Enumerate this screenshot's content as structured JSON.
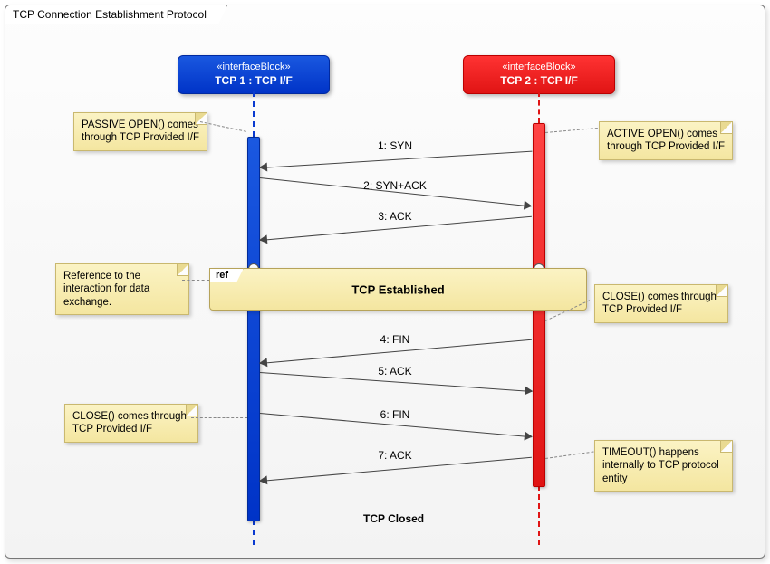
{
  "frame": {
    "title": "TCP Connection Establishment Protocol"
  },
  "lifelines": {
    "tcp1": {
      "stereotype": "«interfaceBlock»",
      "name": "TCP 1 : TCP I/F"
    },
    "tcp2": {
      "stereotype": "«interfaceBlock»",
      "name": "TCP 2 : TCP I/F"
    }
  },
  "messages": {
    "m1": "1: SYN",
    "m2": "2: SYN+ACK",
    "m3": "3: ACK",
    "m4": "4: FIN",
    "m5": "5: ACK",
    "m6": "6: FIN",
    "m7": "7: ACK"
  },
  "ref": {
    "tab": "ref",
    "title": "TCP Established"
  },
  "closed": "TCP Closed",
  "notes": {
    "passive_open": "PASSIVE OPEN() comes through TCP Provided I/F",
    "active_open": "ACTIVE OPEN() comes through TCP Provided I/F",
    "ref_note": "Reference to the interaction for data exchange.",
    "close_right": "CLOSE() comes through TCP Provided I/F",
    "close_left": "CLOSE() comes through TCP Provided I/F",
    "timeout": "TIMEOUT() happens internally to TCP protocol entity"
  }
}
